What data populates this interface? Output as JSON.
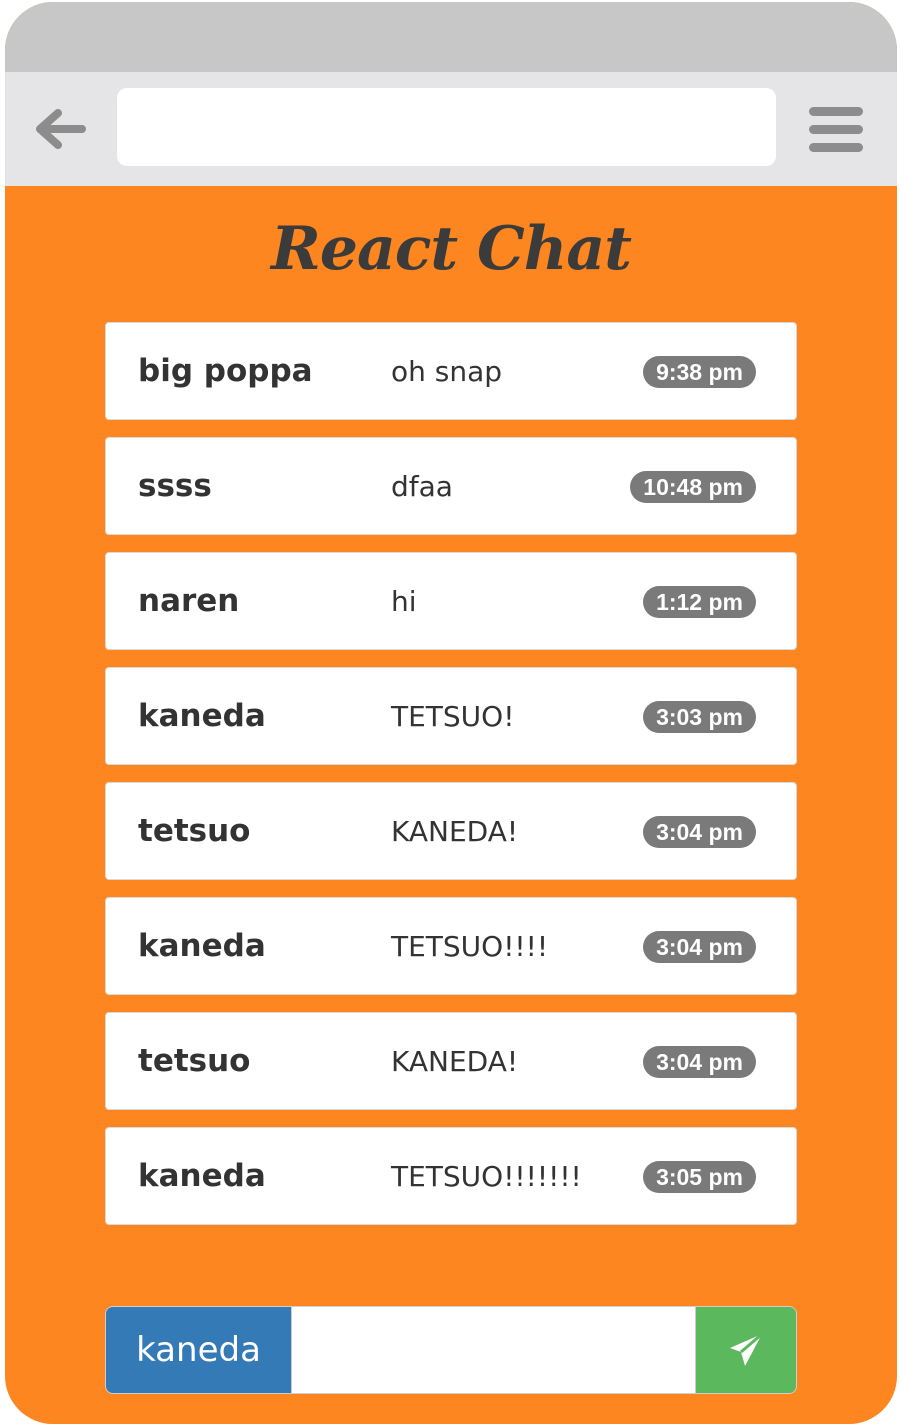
{
  "browser": {
    "url_value": "",
    "back_icon": "back-arrow-icon",
    "menu_icon": "hamburger-menu-icon"
  },
  "app": {
    "title": "React Chat"
  },
  "messages": [
    {
      "user": "big poppa",
      "text": "oh snap",
      "time": "9:38 pm"
    },
    {
      "user": "ssss",
      "text": "dfaa",
      "time": "10:48 pm"
    },
    {
      "user": "naren",
      "text": "hi",
      "time": "1:12 pm"
    },
    {
      "user": "kaneda",
      "text": "TETSUO!",
      "time": "3:03 pm"
    },
    {
      "user": "tetsuo",
      "text": "KANEDA!",
      "time": "3:04 pm"
    },
    {
      "user": "kaneda",
      "text": "TETSUO!!!!",
      "time": "3:04 pm"
    },
    {
      "user": "tetsuo",
      "text": "KANEDA!",
      "time": "3:04 pm"
    },
    {
      "user": "kaneda",
      "text": "TETSUO!!!!!!!",
      "time": "3:05 pm"
    }
  ],
  "composer": {
    "username": "kaneda",
    "message_value": "",
    "send_icon": "paper-plane-icon"
  },
  "colors": {
    "background": "#fd8620",
    "username_addon": "#337ab7",
    "send_button": "#5cb85c",
    "time_badge": "#7a7a7a"
  }
}
